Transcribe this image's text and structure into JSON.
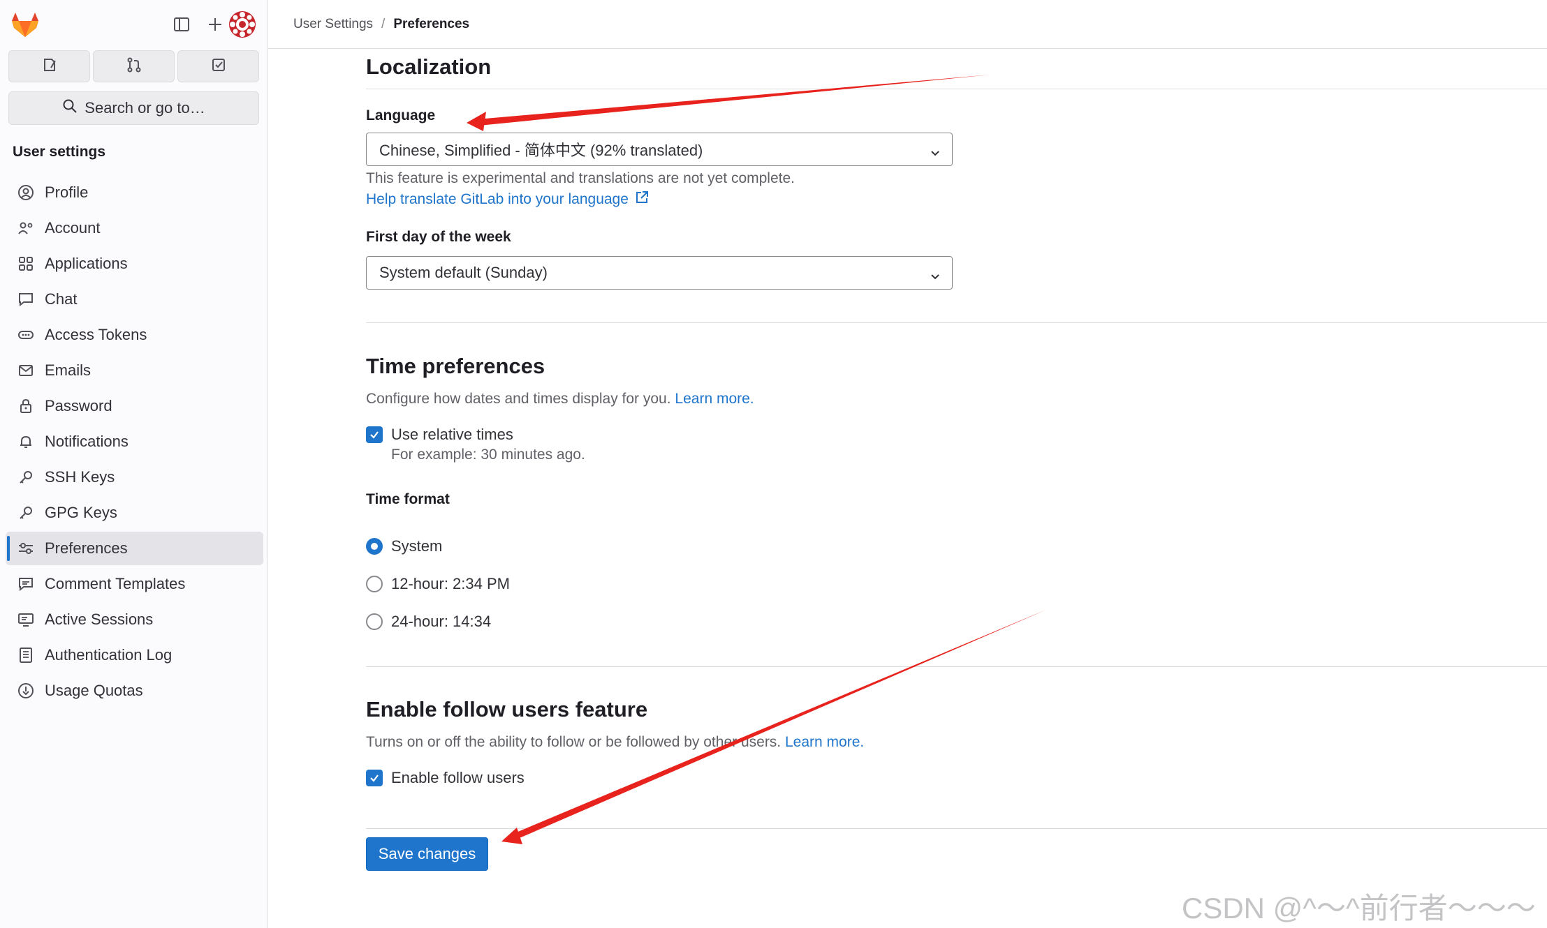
{
  "sidebar": {
    "search_label": "Search or go to…",
    "section_title": "User settings",
    "items": [
      {
        "label": "Profile",
        "icon": "profile-icon"
      },
      {
        "label": "Account",
        "icon": "account-icon"
      },
      {
        "label": "Applications",
        "icon": "applications-icon"
      },
      {
        "label": "Chat",
        "icon": "chat-icon"
      },
      {
        "label": "Access Tokens",
        "icon": "token-icon"
      },
      {
        "label": "Emails",
        "icon": "mail-icon"
      },
      {
        "label": "Password",
        "icon": "lock-icon"
      },
      {
        "label": "Notifications",
        "icon": "bell-icon"
      },
      {
        "label": "SSH Keys",
        "icon": "key-icon"
      },
      {
        "label": "GPG Keys",
        "icon": "key-icon"
      },
      {
        "label": "Preferences",
        "icon": "preferences-icon",
        "active": true
      },
      {
        "label": "Comment Templates",
        "icon": "comment-icon"
      },
      {
        "label": "Active Sessions",
        "icon": "monitor-icon"
      },
      {
        "label": "Authentication Log",
        "icon": "log-icon"
      },
      {
        "label": "Usage Quotas",
        "icon": "quota-icon"
      }
    ]
  },
  "breadcrumb": {
    "parent": "User Settings",
    "separator": "/",
    "current": "Preferences"
  },
  "localization": {
    "title": "Localization",
    "language_label": "Language",
    "language_value": "Chinese, Simplified - 简体中文 (92% translated)",
    "language_help": "This feature is experimental and translations are not yet complete.",
    "language_link": "Help translate GitLab into your language",
    "week_label": "First day of the week",
    "week_value": "System default (Sunday)"
  },
  "time": {
    "title": "Time preferences",
    "description": "Configure how dates and times display for you.",
    "learn_more": "Learn more.",
    "relative_label": "Use relative times",
    "relative_help": "For example: 30 minutes ago.",
    "format_label": "Time format",
    "options": [
      "System",
      "12-hour: 2:34 PM",
      "24-hour: 14:34"
    ],
    "selected": "System"
  },
  "follow": {
    "title": "Enable follow users feature",
    "description": "Turns on or off the ability to follow or be followed by other users.",
    "learn_more": "Learn more.",
    "checkbox_label": "Enable follow users"
  },
  "actions": {
    "save_label": "Save changes"
  },
  "watermark": "CSDN @^～^前行者～～～",
  "colors": {
    "accent": "#1f75cb",
    "annotation_arrow": "#e8231d"
  }
}
